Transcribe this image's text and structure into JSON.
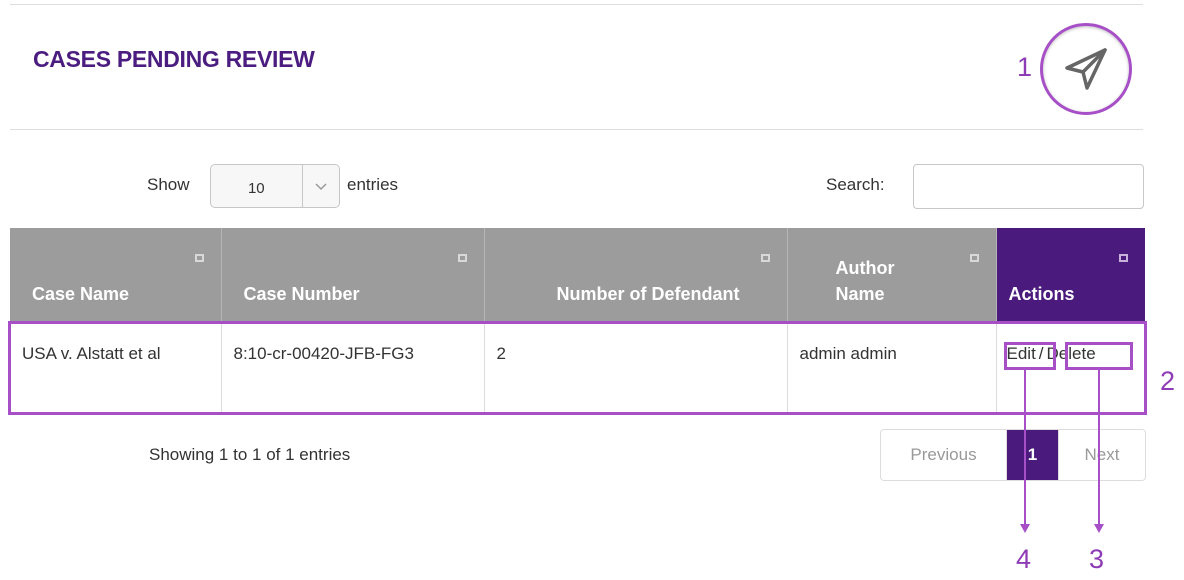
{
  "header": {
    "title": "CASES PENDING REVIEW",
    "send_icon": "paper-plane-icon"
  },
  "annotations": {
    "label_1": "1",
    "label_2": "2",
    "label_3": "3",
    "label_4": "4"
  },
  "controls": {
    "show_label": "Show",
    "entries_value": "10",
    "entries_label": "entries",
    "search_label": "Search:",
    "search_value": ""
  },
  "table": {
    "columns": [
      "Case Name",
      "Case Number",
      "Number of Defendant",
      "Author Name",
      "Actions"
    ],
    "rows": [
      {
        "case_name": "USA v. Alstatt et al",
        "case_number": "8:10-cr-00420-JFB-FG3",
        "defendants": "2",
        "author": "admin admin",
        "edit_label": "Edit",
        "separator": "/",
        "delete_label": "Delete"
      }
    ]
  },
  "footer": {
    "showing_text": "Showing 1 to 1 of 1 entries",
    "previous_label": "Previous",
    "current_page": "1",
    "next_label": "Next"
  },
  "colors": {
    "accent": "#4a1a7c",
    "annotation": "#a64fc6",
    "header_gray": "#9c9c9c"
  }
}
